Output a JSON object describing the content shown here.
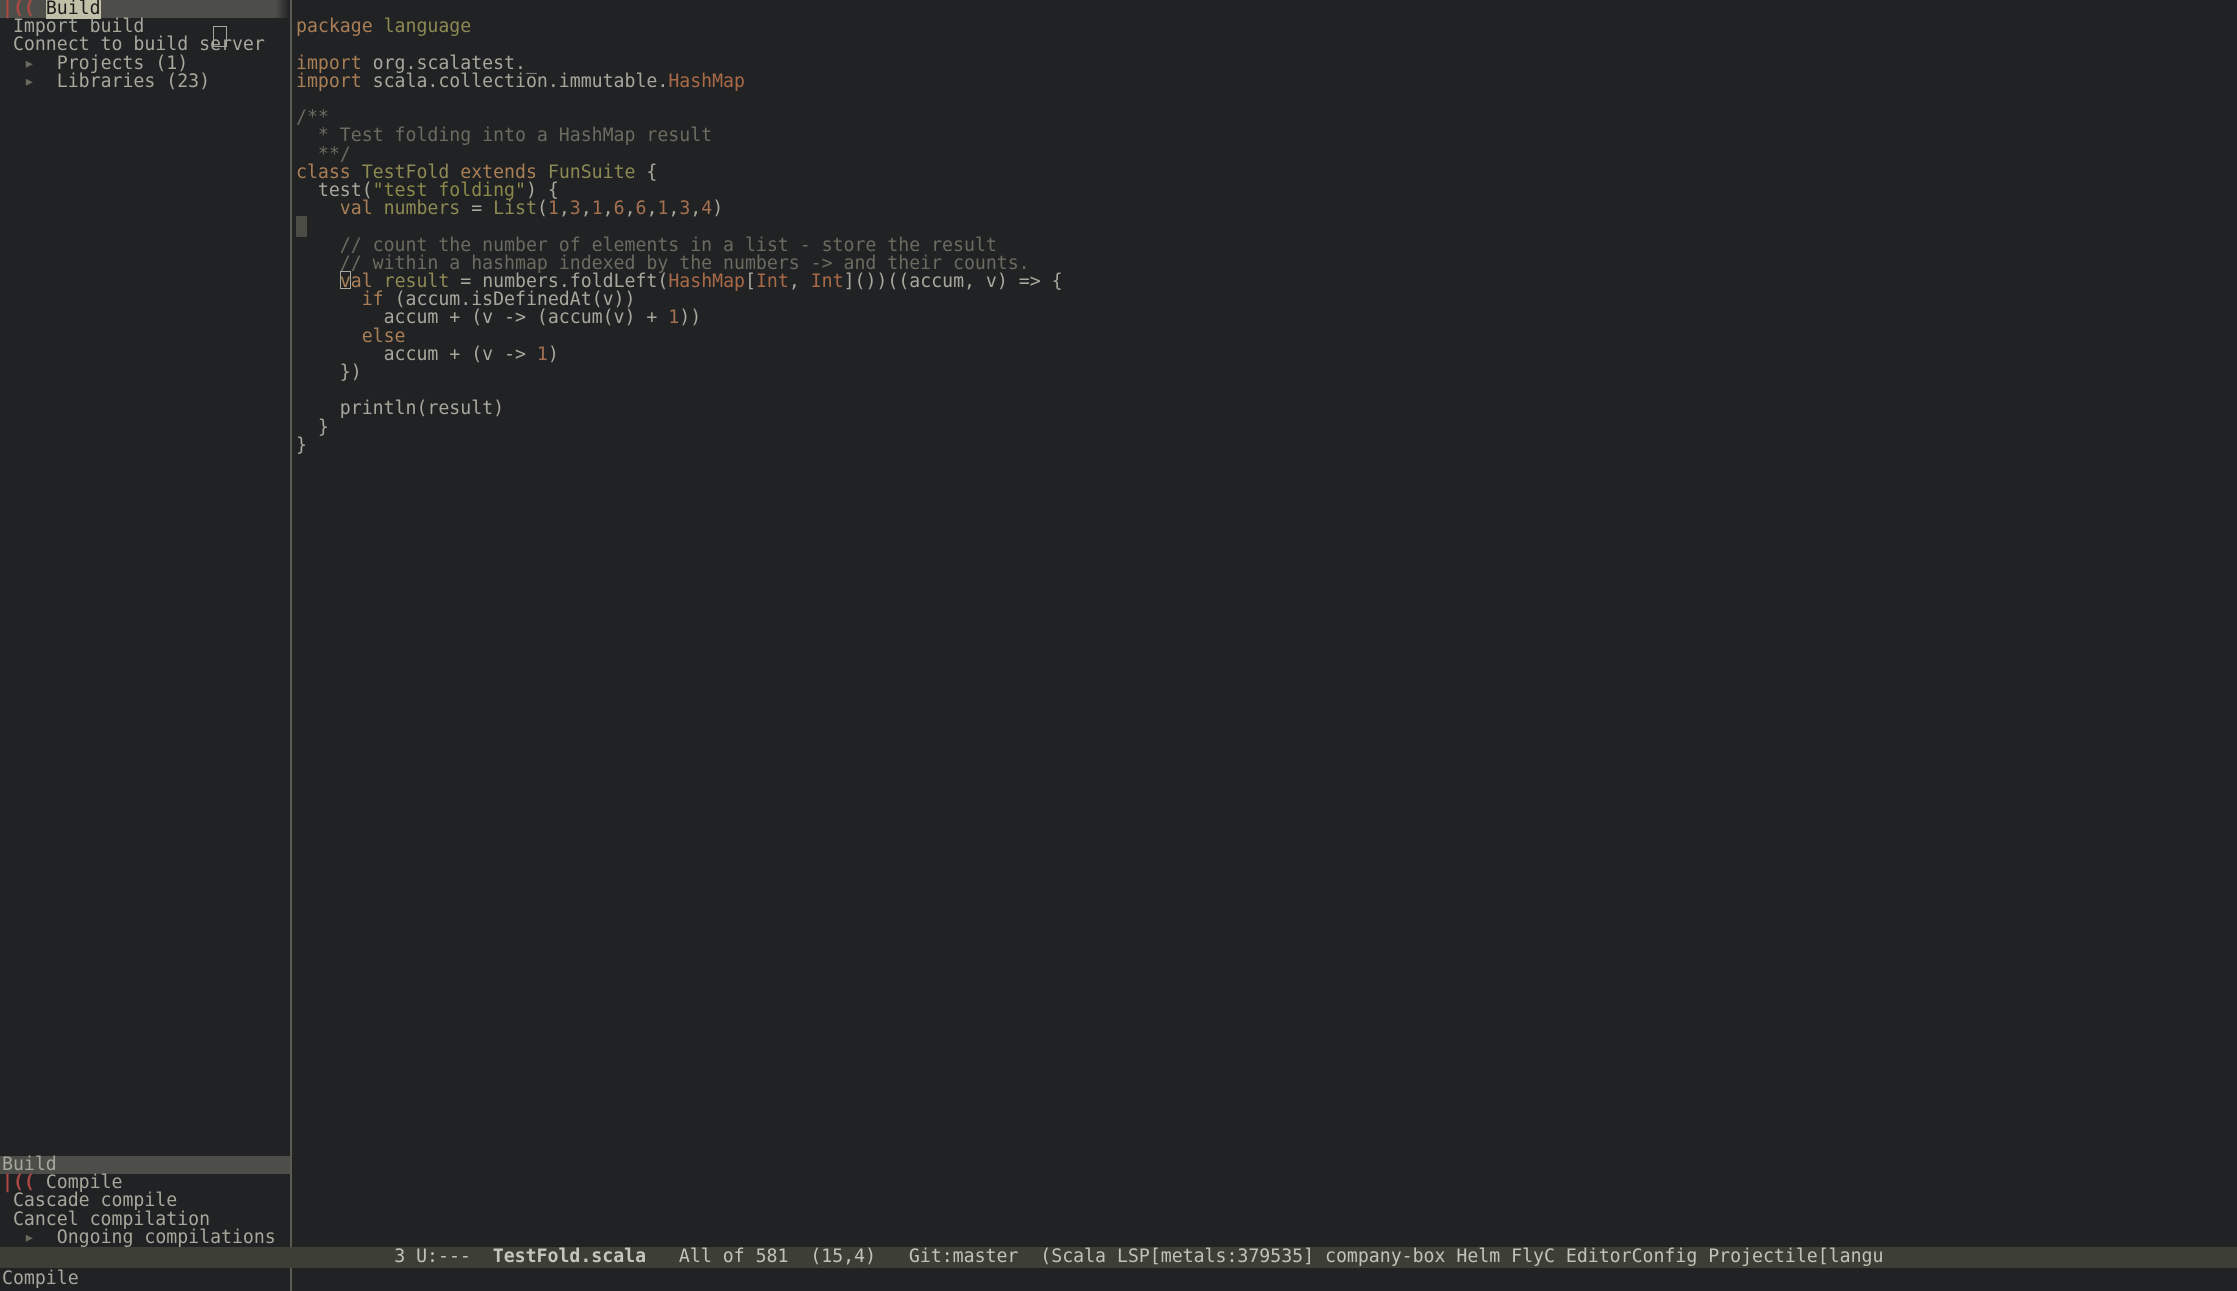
{
  "sidebar": {
    "top_header": "Build",
    "items": [
      "Import build",
      "Connect to build server",
      "Projects (1)",
      "Libraries (23)"
    ],
    "bottom_header": "Build",
    "build_items": [
      "Compile",
      "Cascade compile",
      "Cancel compilation",
      "Ongoing compilations"
    ]
  },
  "code": {
    "pkg_kw": "package",
    "pkg_name": " language",
    "imp_kw": "import",
    "imp1": " org.scalatest._",
    "imp2a": " scala.collection.immutable.",
    "imp2b": "HashMap",
    "doc1": "/**",
    "doc2": "  * Test folding into a HashMap result",
    "doc3": "  **/",
    "class_kw": "class ",
    "class_name": "TestFold",
    "extends_kw": " extends ",
    "fun": "FunSuite",
    "ob": " {",
    "test_call": "  test(",
    "test_str": "\"test folding\"",
    "test_tail": ") {",
    "val_kw": "    val ",
    "numbers": "numbers",
    "eq": " = ",
    "list": "List",
    "lp": "(",
    "n1": "1",
    "c": ",",
    "n3": "3",
    "n6": "6",
    "n4": "4",
    "rp": ")",
    "c1": "    // count the number of elements in a list - store the result",
    "c2": "    // within a hashmap indexed by the numbers -> and their counts.",
    "l_val": "    ",
    "val2": "val ",
    "res": "result",
    "eq2": " = ",
    "fold": "numbers.foldLeft(",
    "hm": "HashMap",
    "br": "[",
    "int": "Int",
    "cm2": ", ",
    "rbr": "]",
    "tail2": "())((accum, v) => {",
    "if_kw": "      if ",
    "if_tail": "(accum.isDefinedAt(v))",
    "acc1": "        accum + (v -> (accum(v) + ",
    "one": "1",
    "acc1t": "))",
    "else_kw": "      else",
    "acc2": "        accum + (v -> ",
    "acc2t": ")",
    "close": "    })",
    "println": "    println(result)",
    "cb1": "  }",
    "cb0": "}"
  },
  "modeline": {
    "left_fill": "                                    ",
    "num": "3",
    "u": " U:--- ",
    "file": " TestFold.scala ",
    "allof": "  All of 581  ",
    "pos": "(15,4) ",
    "git": "  Git:master  ",
    "modes": "(Scala LSP[metals:379535] company-box Helm FlyC EditorConfig Projectile[langu"
  },
  "echo": "Compile"
}
